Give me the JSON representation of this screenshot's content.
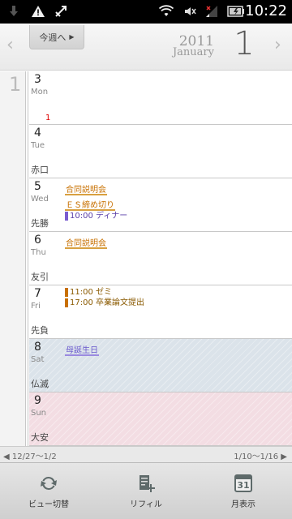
{
  "status_bar": {
    "time": "10:22",
    "icons": [
      "download-icon",
      "warning-icon",
      "usb-debug-icon",
      "wifi-icon",
      "mute-icon",
      "signal-icon",
      "battery-icon"
    ]
  },
  "header": {
    "week_button": "今週へ",
    "year": "2011",
    "month_name": "January",
    "month_number": "1",
    "prev_arrow": "‹",
    "next_arrow": "›"
  },
  "calendar": {
    "week_number": "1",
    "days": [
      {
        "num": "3",
        "name": "Mon",
        "rokuyo": "",
        "badge": "1",
        "events": []
      },
      {
        "num": "4",
        "name": "Tue",
        "rokuyo": "赤口",
        "events": []
      },
      {
        "num": "5",
        "name": "Wed",
        "rokuyo": "先勝",
        "events": [
          {
            "type": "allday",
            "color": "orange",
            "text": "合同説明会"
          },
          {
            "type": "allday",
            "color": "orange",
            "text": "ＥＳ締め切り"
          },
          {
            "type": "timed",
            "color": "purple",
            "text": "10:00 ディナー"
          }
        ]
      },
      {
        "num": "6",
        "name": "Thu",
        "rokuyo": "友引",
        "events": [
          {
            "type": "allday",
            "color": "orange",
            "text": "合同説明会"
          }
        ]
      },
      {
        "num": "7",
        "name": "Fri",
        "rokuyo": "先負",
        "events": [
          {
            "type": "timed",
            "color": "brown",
            "text": "11:00 ゼミ"
          },
          {
            "type": "timed",
            "color": "brown",
            "text": "17:00 卒業論文提出"
          }
        ]
      },
      {
        "num": "8",
        "name": "Sat",
        "rokuyo": "仏滅",
        "events": [
          {
            "type": "allday",
            "color": "purple",
            "text": "母誕生日"
          }
        ]
      },
      {
        "num": "9",
        "name": "Sun",
        "rokuyo": "大安",
        "events": []
      }
    ]
  },
  "week_nav": {
    "prev": "◀ 12/27〜1/2",
    "next": "1/10〜1/16 ▶"
  },
  "toolbar": {
    "view_switch": "ビュー切替",
    "refill": "リフィル",
    "month_view": "月表示",
    "month_icon_num": "31"
  },
  "colors": {
    "orange_event": "#c87000",
    "purple_event": "#6a5acd",
    "saturday_bg": "#dbe3ea",
    "sunday_bg": "#f3dde3"
  }
}
